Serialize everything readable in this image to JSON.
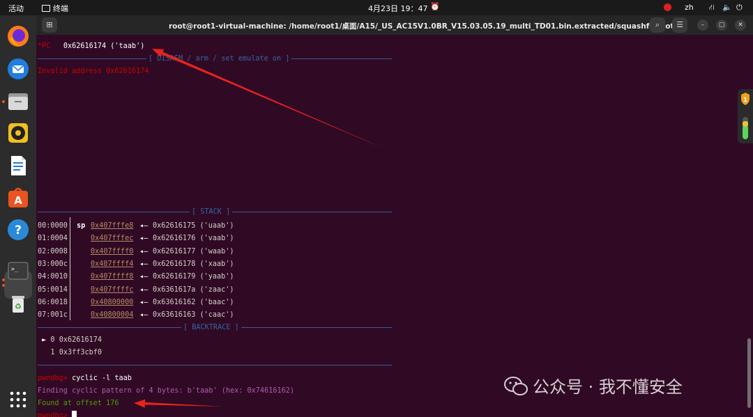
{
  "topbar": {
    "activities": "活动",
    "app_name": "终端",
    "datetime": "4月23日  19：47",
    "input_method": "zh"
  },
  "titlebar": {
    "title": "root@root1-virtual-machine: /home/root1/桌面/A15/_US_AC15V1.0BR_V15.03.05.19_multi_TD01.bin.extracted/squashfs-root"
  },
  "dock": {
    "items": [
      "firefox-icon",
      "thunderbird-icon",
      "files-icon",
      "rhythmbox-icon",
      "writer-icon",
      "app-center-icon",
      "help-icon",
      "terminal-icon",
      "trash-icon",
      "app-grid-icon"
    ]
  },
  "terminal": {
    "pc_label": "*PC",
    "pc_value": "0x62616174 ('taab')",
    "disasm_header": "[ DISASM / arm / set emulate on ]",
    "invalid_address": "Invalid address 0x62616174",
    "stack_header": "[ STACK ]",
    "stack": [
      {
        "offset": "00:0000",
        "reg": "sp",
        "addr": "0x407fffe8",
        "value": "0x62616175 ('uaab')"
      },
      {
        "offset": "01:0004",
        "reg": "",
        "addr": "0x407fffec",
        "value": "0x62616176 ('vaab')"
      },
      {
        "offset": "02:0008",
        "reg": "",
        "addr": "0x407ffff0",
        "value": "0x62616177 ('waab')"
      },
      {
        "offset": "03:000c",
        "reg": "",
        "addr": "0x407ffff4",
        "value": "0x62616178 ('xaab')"
      },
      {
        "offset": "04:0010",
        "reg": "",
        "addr": "0x407ffff8",
        "value": "0x62616179 ('yaab')"
      },
      {
        "offset": "05:0014",
        "reg": "",
        "addr": "0x407ffffc",
        "value": "0x6361617a ('zaac')"
      },
      {
        "offset": "06:0018",
        "reg": "",
        "addr": "0x40800000",
        "value": "0x63616162 ('baac')"
      },
      {
        "offset": "07:001c",
        "reg": "",
        "addr": "0x40800004",
        "value": "0x63616163 ('caac')"
      }
    ],
    "arrow": "◂—",
    "backtrace_header": "[ BACKTRACE ]",
    "backtrace": [
      {
        "marker": "►",
        "index": "0",
        "addr": "0x62616174"
      },
      {
        "marker": "",
        "index": "1",
        "addr": "0x3ff3cbf0"
      }
    ],
    "prompt": "pwndbg>",
    "command": "cyclic -l taab",
    "finding_line": "Finding cyclic pattern of 4 bytes: b'taab' (hex: 0x74616162)",
    "found_line": "Found at offset 176",
    "annotation_color": "#e8231e"
  },
  "watermark": {
    "text": "公众号 · 我不懂安全"
  }
}
